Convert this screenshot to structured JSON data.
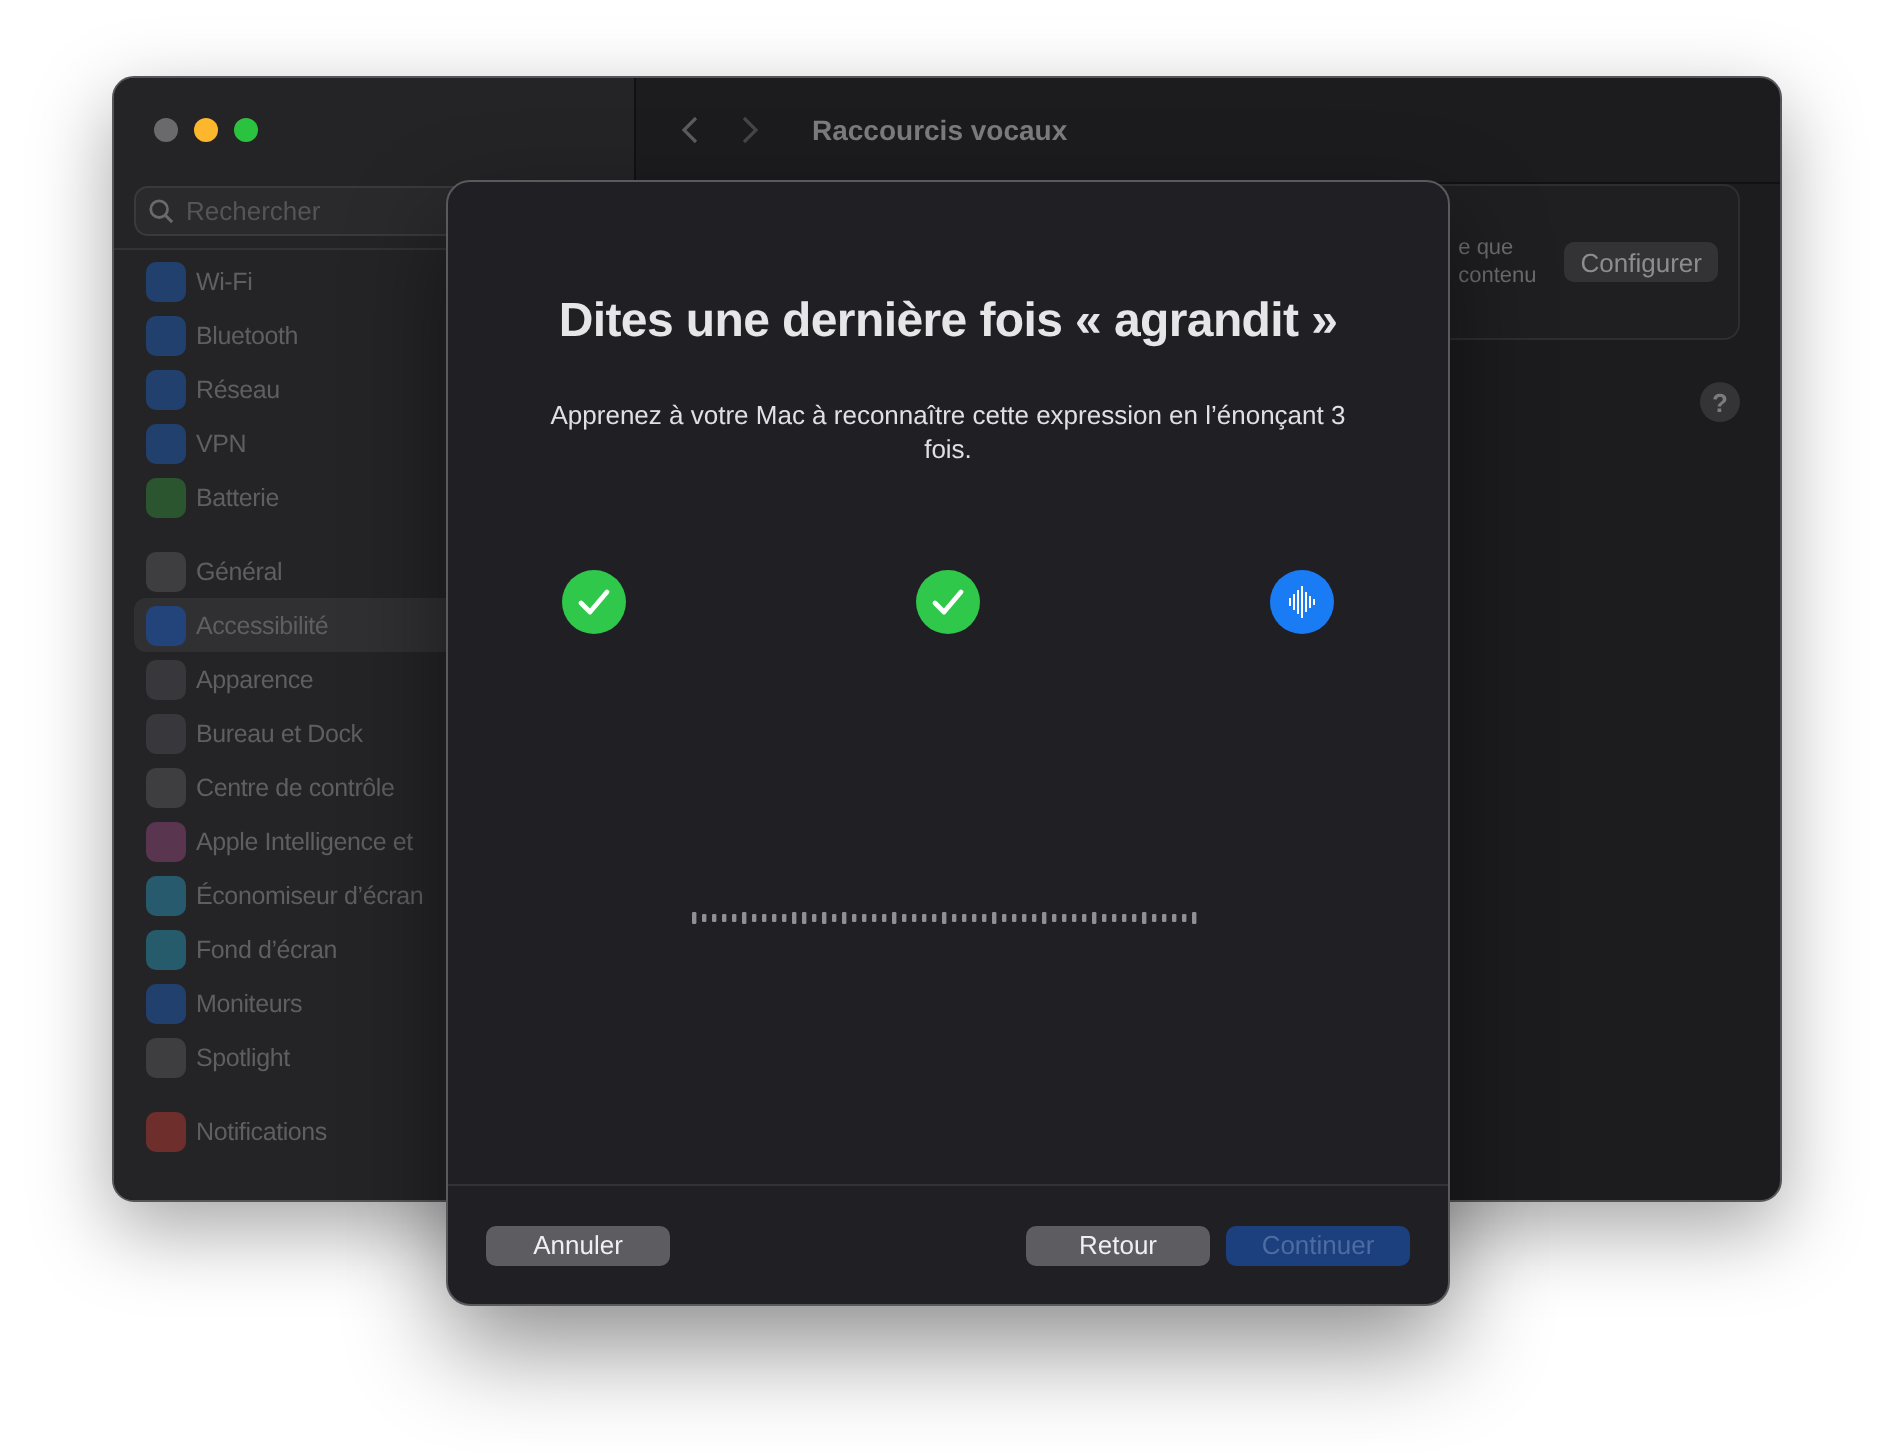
{
  "window": {
    "title": "Raccourcis vocaux"
  },
  "sidebar": {
    "search": {
      "placeholder": "Rechercher"
    },
    "groups": [
      {
        "items": [
          {
            "label": "Wi-Fi",
            "selected": false
          },
          {
            "label": "Bluetooth",
            "selected": false
          },
          {
            "label": "Réseau",
            "selected": false
          },
          {
            "label": "VPN",
            "selected": false
          },
          {
            "label": "Batterie",
            "selected": false
          }
        ]
      },
      {
        "items": [
          {
            "label": "Général",
            "selected": false
          },
          {
            "label": "Accessibilité",
            "selected": true
          },
          {
            "label": "Apparence",
            "selected": false
          },
          {
            "label": "Bureau et Dock",
            "selected": false
          },
          {
            "label": "Centre de contrôle",
            "selected": false
          },
          {
            "label": "Apple Intelligence et",
            "selected": false
          },
          {
            "label": "Économiseur d’écran",
            "selected": false
          },
          {
            "label": "Fond d’écran",
            "selected": false
          },
          {
            "label": "Moniteurs",
            "selected": false
          },
          {
            "label": "Spotlight",
            "selected": false
          }
        ]
      },
      {
        "items": [
          {
            "label": "Notifications",
            "selected": false
          }
        ]
      }
    ]
  },
  "content": {
    "card": {
      "lines": [
        "e que",
        "contenu"
      ],
      "button": "Configurer"
    },
    "help": "?"
  },
  "dialog": {
    "title": "Dites une dernière fois « agrandit »",
    "subtitle": "Apprenez à votre Mac à reconnaître cette expression en l’énonçant 3 fois.",
    "steps": [
      {
        "kind": "done"
      },
      {
        "kind": "done"
      },
      {
        "kind": "listening"
      }
    ],
    "buttons": [
      {
        "label": "Annuler",
        "kind": "normal",
        "disabled": false
      },
      {
        "label": "Retour",
        "kind": "normal",
        "disabled": false
      },
      {
        "label": "Continuer",
        "kind": "primary",
        "disabled": true
      }
    ]
  }
}
